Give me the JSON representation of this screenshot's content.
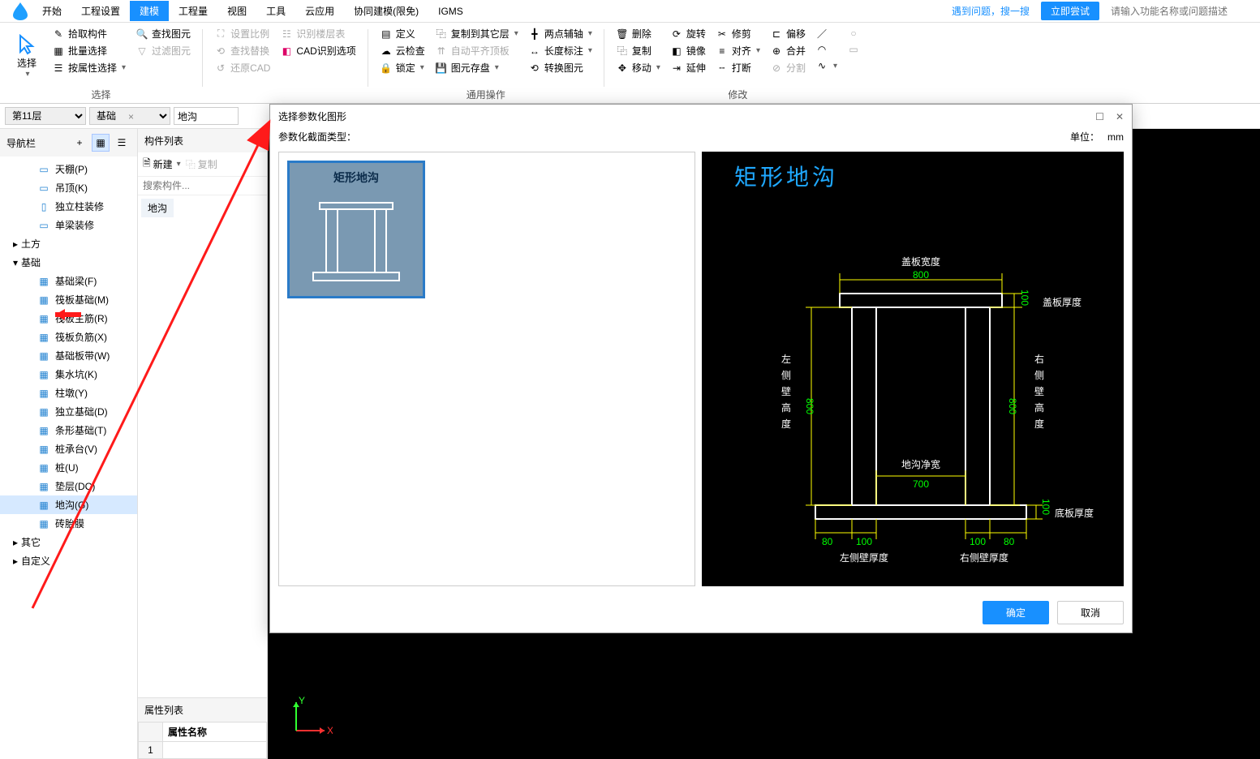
{
  "menubar": {
    "items": [
      "开始",
      "工程设置",
      "建模",
      "工程量",
      "视图",
      "工具",
      "云应用",
      "协同建模(限免)",
      "IGMS"
    ],
    "active_index": 2,
    "right_link": "遇到问题，搜一搜",
    "try_btn": "立即尝试",
    "search_ph": "请输入功能名称或问题描述"
  },
  "ribbon": {
    "select_big": "选择",
    "g1": {
      "pick": "拾取构件",
      "batch": "批量选择",
      "filter": "过滤图元",
      "attr": "按属性选择",
      "title": "选择"
    },
    "g2": {
      "find": "查找图元",
      "replace": "查找替换",
      "scale": "设置比例",
      "layer": "识别楼层表",
      "cad": "CAD识别选项",
      "restore": "还原CAD"
    },
    "g3": {
      "define": "定义",
      "cloud": "云检查",
      "lock": "锁定",
      "copy_floor": "复制到其它层",
      "auto": "自动平齐顶板",
      "save_unit": "图元存盘",
      "axis": "两点辅轴",
      "len": "长度标注",
      "convert": "转换图元",
      "title": "通用操作"
    },
    "g4": {
      "del": "删除",
      "copy": "复制",
      "move": "移动",
      "rotate": "旋转",
      "mirror": "镜像",
      "extend": "延伸",
      "trim": "修剪",
      "align": "对齐",
      "break": "打断",
      "offset": "偏移",
      "merge": "合并",
      "split": "分割",
      "title": "修改"
    }
  },
  "filter": {
    "floor": "第11层",
    "cat": "基础",
    "item": "地沟"
  },
  "nav": {
    "title": "导航栏",
    "view_grid_tip": "grid",
    "view_list_tip": "list",
    "leaves_top": [
      "天棚(P)",
      "吊顶(K)",
      "独立柱装修",
      "单梁装修"
    ],
    "root_tufang": "土方",
    "root_jichu": "基础",
    "jichu_items": [
      "基础梁(F)",
      "筏板基础(M)",
      "筏板主筋(R)",
      "筏板负筋(X)",
      "基础板带(W)",
      "集水坑(K)",
      "柱墩(Y)",
      "独立基础(D)",
      "条形基础(T)",
      "桩承台(V)",
      "桩(U)",
      "垫层(DC)",
      "地沟(G)",
      "砖胎膜"
    ],
    "root_qita": "其它",
    "root_zidingyi": "自定义"
  },
  "comp": {
    "title": "构件列表",
    "new": "新建",
    "copy": "复制",
    "search_ph": "搜索构件...",
    "item": "地沟",
    "prop_title": "属性列表",
    "prop_col": "属性名称"
  },
  "dialog": {
    "title": "选择参数化图形",
    "type_label": "参数化截面类型：",
    "unit_label": "单位：",
    "unit_value": "mm",
    "card_label": "矩形地沟",
    "preview_title": "矩形地沟",
    "ok": "确定",
    "cancel": "取消",
    "dims": {
      "cover_w_label": "盖板宽度",
      "cover_w": "800",
      "cover_t_label": "盖板厚度",
      "cover_t": "100",
      "left_h_label": "左\n侧\n壁\n高\n度",
      "left_h": "800",
      "right_h_label": "右\n侧\n壁\n高\n度",
      "right_h": "800",
      "inner_w_label": "地沟净宽",
      "inner_w": "700",
      "bottom_t_label": "底板厚度",
      "bottom_t": "100",
      "left_t_label": "左侧壁厚度",
      "right_t_label": "右侧壁厚度",
      "lt_a": "80",
      "lt_b": "100",
      "rt_a": "100",
      "rt_b": "80"
    }
  },
  "axis": {
    "x": "X",
    "y": "Y"
  }
}
